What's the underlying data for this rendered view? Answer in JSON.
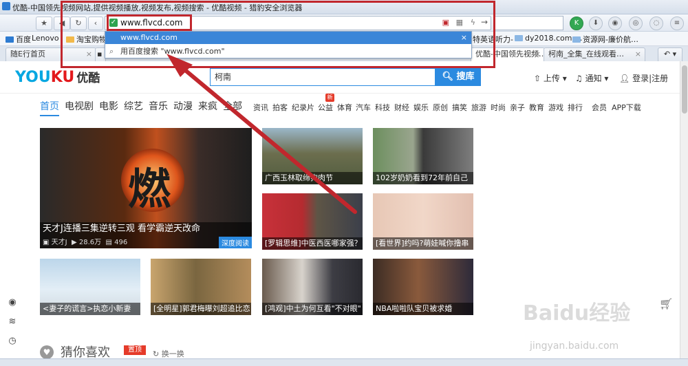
{
  "window": {
    "title": "优酷-中国领先视频网站,提供视频播放,视频发布,视频搜索 - 优酷视频 - 猎豹安全浏览器"
  },
  "nav": {
    "url": "www.flvcd.com",
    "back": "◀",
    "refresh": "↻",
    "star": "★"
  },
  "bookmarks": [
    "百度",
    "Lenovo",
    "淘宝购物",
    "…特英语听力-",
    "dy2018.com-…",
    "资源网-廉价航…"
  ],
  "tabs": [
    {
      "label": "随E行首页"
    },
    {
      "label": "优酷-中国领先视频…"
    },
    {
      "label": "柯南_全集_在线观看…"
    }
  ],
  "dropdown": {
    "highlight": "www.flvcd.com",
    "suggest": "用百度搜索 \"www.flvcd.com\""
  },
  "header": {
    "logo_a": "YOU",
    "logo_b": "KU",
    "logo_cn": "优酷",
    "search_value": "柯南",
    "search_button": "搜库",
    "upload": "上传",
    "notify": "通知",
    "login": "登录|注册"
  },
  "channels_main": [
    "首页",
    "电视剧",
    "电影",
    "综艺",
    "音乐",
    "动漫",
    "来疯",
    "全部"
  ],
  "channels_sub": [
    "资讯",
    "拍客",
    "纪录片",
    "公益",
    "体育",
    "汽车",
    "科技",
    "财经",
    "娱乐",
    "原创",
    "搞笑",
    "旅游",
    "时尚",
    "亲子",
    "教育",
    "游戏",
    "排行",
    "会员",
    "APP下载"
  ],
  "new_badge": "新",
  "tiles": {
    "main": {
      "caption": "天才J连播三集逆转三观 看学霸逆天改命",
      "uploader": "天才J",
      "views": "28.6万",
      "comments": "496",
      "tag": "深度阅读",
      "poster_text": "燃"
    },
    "t1": "广西玉林取缔狗肉节",
    "t2": "102岁奶奶看到72年前自己",
    "t3": "[罗辑思维]中医西医哪家强？",
    "t4": "[看世界]约吗?萌娃喊你撸串",
    "t5": "<妻子的谎言>执恋小新妻",
    "t6": "[全明星]郭君梅曝刘超追比恋",
    "t7": "[鸿观]中土为何互看\"不对眼\"",
    "t8": "NBA啦啦队宝贝被求婚"
  },
  "bottom": {
    "title": "猜你喜欢",
    "badge": "置顶",
    "refresh": "换一换"
  },
  "watermark": {
    "main": "Baidu经验",
    "sub": "jingyan.baidu.com"
  },
  "colors": {
    "accent": "#2b8ae0",
    "highlight": "#c1272d",
    "youku_blue": "#06a7e1",
    "youku_red": "#e3191c"
  }
}
